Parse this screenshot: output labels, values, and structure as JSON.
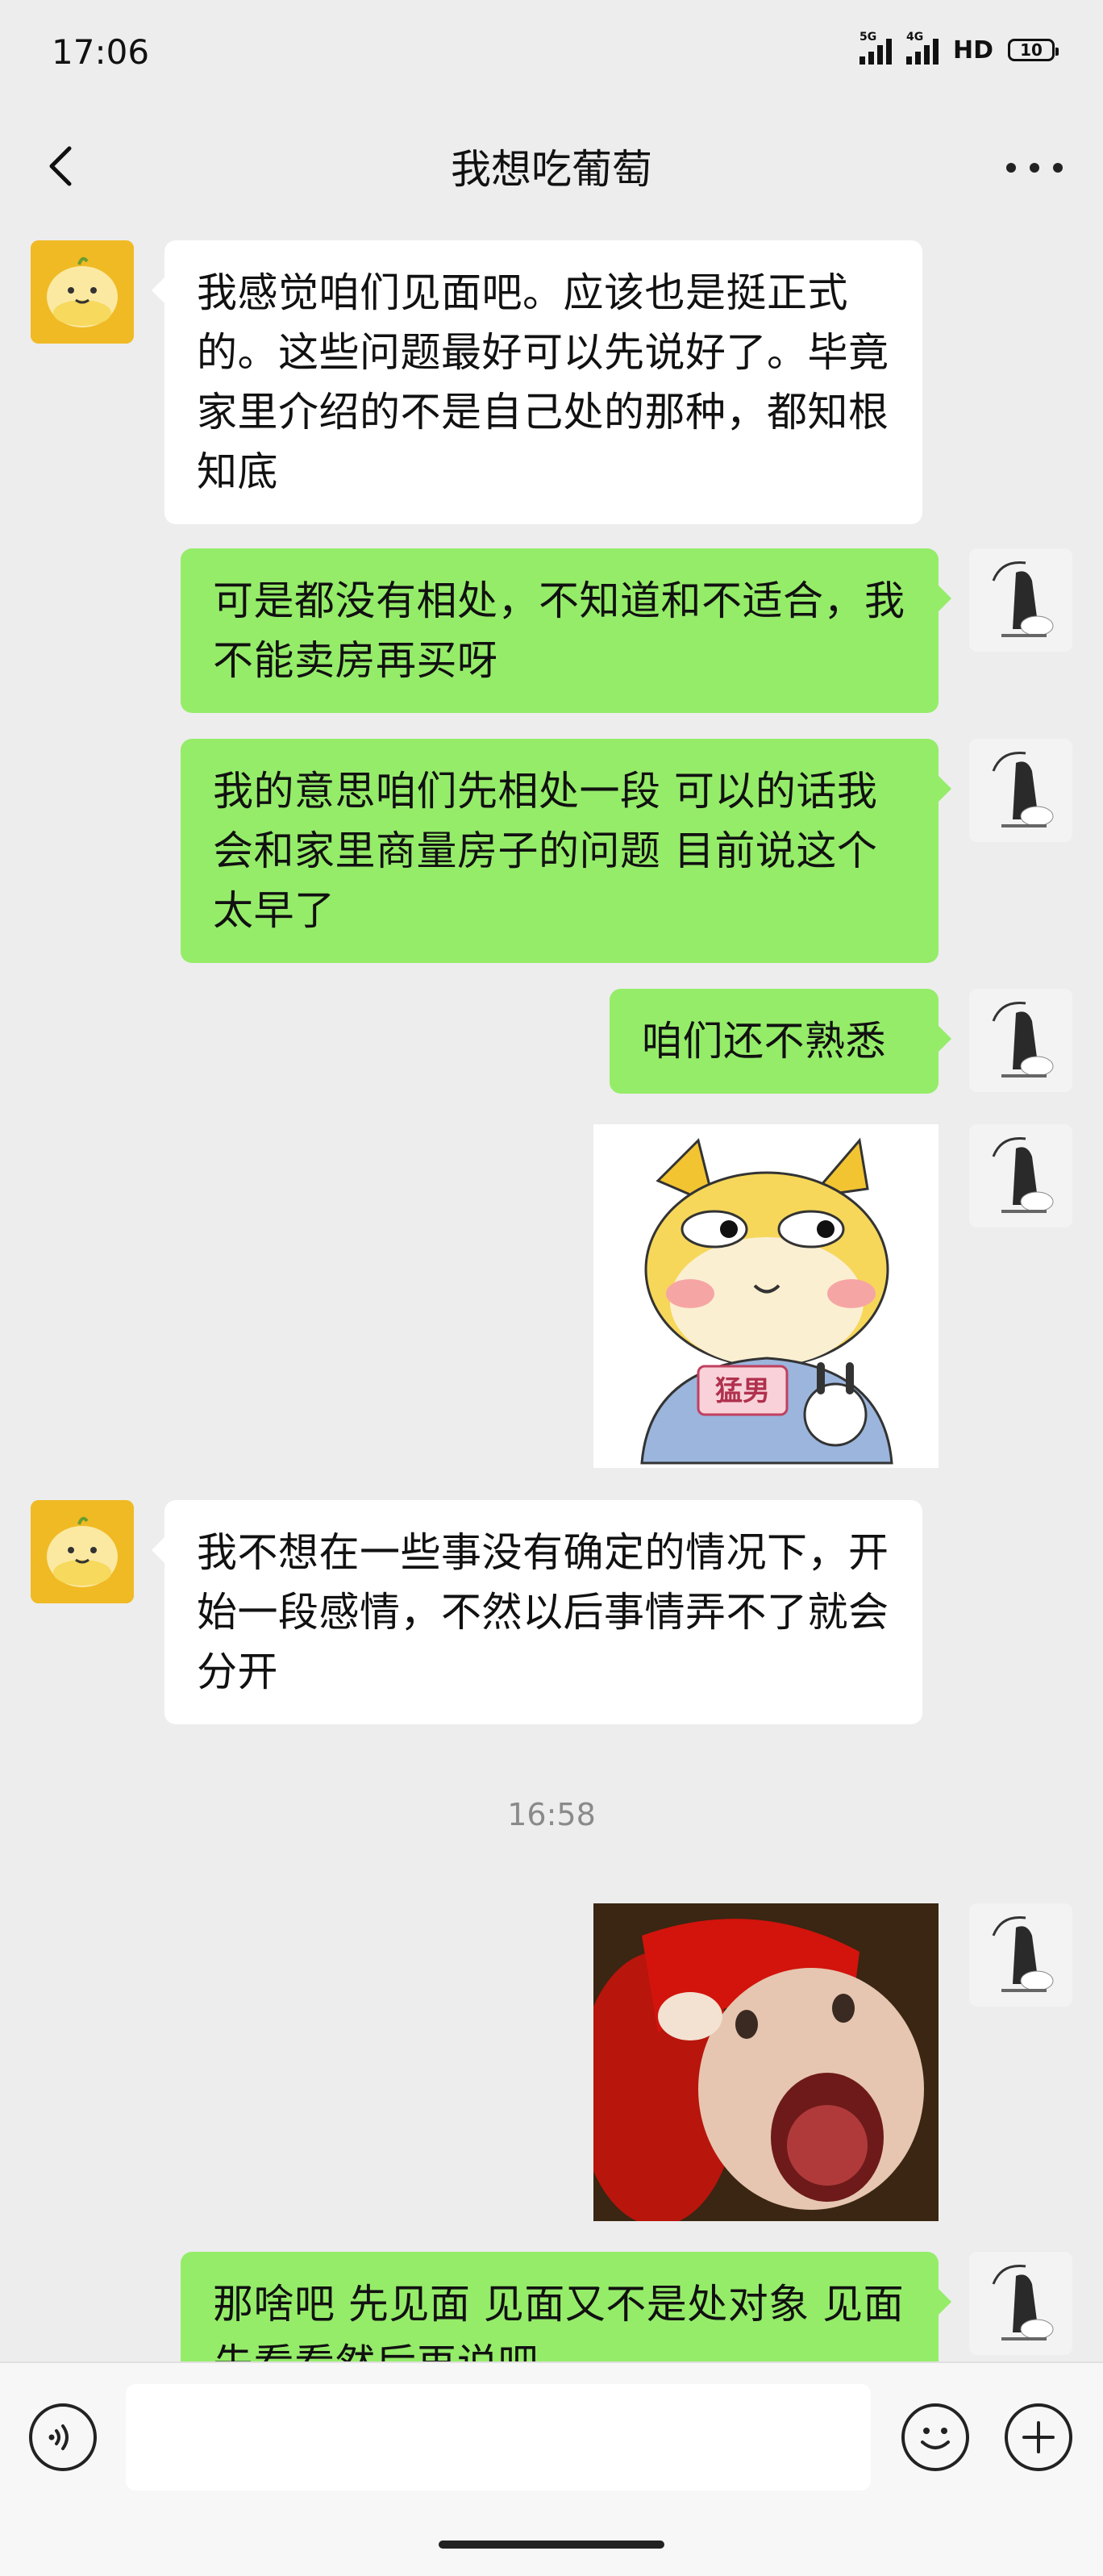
{
  "status_bar": {
    "time": "17:06",
    "network_1": "5G",
    "network_2": "4G",
    "hd_label": "HD",
    "battery": "10"
  },
  "nav": {
    "back_icon": "chevron-left-icon",
    "title": "我想吃葡萄",
    "more_icon": "more-dots-icon"
  },
  "messages": [
    {
      "sender": "other",
      "type": "text",
      "text": "我感觉咱们见面吧。应该也是挺正式的。这些问题最好可以先说好了。毕竟家里介绍的不是自己处的那种，都知根知底"
    },
    {
      "sender": "self",
      "type": "text",
      "text": "可是都没有相处，不知道和不适合，我不能卖房再买呀"
    },
    {
      "sender": "self",
      "type": "text",
      "text": "我的意思咱们先相处一段 可以的话我会和家里商量房子的问题 目前说这个太早了"
    },
    {
      "sender": "self",
      "type": "text",
      "text": "咱们还不熟悉"
    },
    {
      "sender": "self",
      "type": "sticker",
      "sticker_text": "猛男"
    },
    {
      "sender": "other",
      "type": "text",
      "text": "我不想在一些事没有确定的情况下，开始一段感情，不然以后事情弄不了就会分开"
    },
    {
      "sender": "self",
      "type": "sticker",
      "sticker_text": ""
    },
    {
      "sender": "self",
      "type": "text",
      "text": "那啥吧 先见面 见面又不是处对象 见面先看看然后再说吧"
    }
  ],
  "timestamp": "16:58",
  "input_bar": {
    "voice_icon": "voice-icon",
    "placeholder": "",
    "emoji_icon": "emoji-icon",
    "plus_icon": "plus-icon"
  },
  "colors": {
    "background": "#ededed",
    "self_bubble": "#95ec69",
    "other_bubble": "#ffffff",
    "other_avatar": "#f0ba25"
  }
}
